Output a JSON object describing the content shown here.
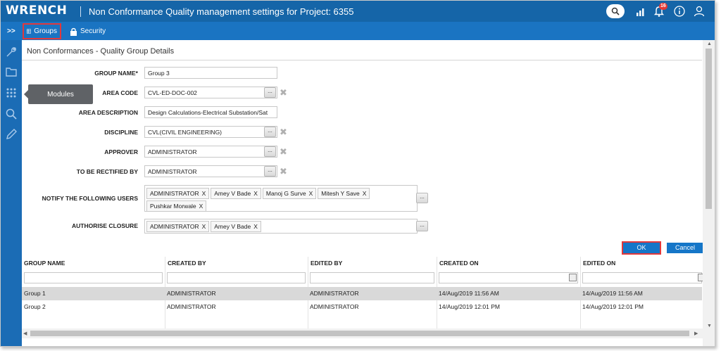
{
  "header": {
    "logo": "WRENCH",
    "title": "Non Conformance Quality management settings for Project: 6355",
    "notification_count": "16",
    "icons": [
      "search-icon",
      "signal-icon",
      "bell-icon",
      "info-icon",
      "user-icon"
    ]
  },
  "tabs": [
    {
      "label": "Groups",
      "icon": "grid-icon"
    },
    {
      "label": "Security",
      "icon": "lock-icon"
    }
  ],
  "sidebar": {
    "expand": ">>",
    "icons": [
      "wrench-icon",
      "folder-icon",
      "modules-icon",
      "search-icon",
      "pencil-icon"
    ],
    "tooltip": "Modules"
  },
  "section_title": "Non Conformances - Quality Group Details",
  "form": {
    "group_name": {
      "label": "GROUP NAME*",
      "value": "Group 3"
    },
    "area_code": {
      "label": "AREA CODE",
      "value": "CVL-ED-DOC-002"
    },
    "area_description": {
      "label": "AREA DESCRIPTION",
      "value": "Design Calculations-Electrical Substation/Sat"
    },
    "discipline": {
      "label": "DISCIPLINE",
      "value": "CVL(CIVIL ENGINEERING)"
    },
    "approver": {
      "label": "APPROVER",
      "value": "ADMINISTRATOR"
    },
    "to_be_rectified_by": {
      "label": "TO BE RECTIFIED BY",
      "value": "ADMINISTRATOR"
    },
    "notify_users": {
      "label": "NOTIFY THE FOLLOWING USERS",
      "tags": [
        "ADMINISTRATOR",
        "Amey V Bade",
        "Manoj G Surve",
        "Mitesh Y Save",
        "Pushkar Morwale"
      ]
    },
    "authorise_closure": {
      "label": "AUTHORISE CLOSURE",
      "tags": [
        "ADMINISTRATOR",
        "Amey V Bade"
      ]
    },
    "dots_label": "...",
    "clear_label": "✖",
    "tag_remove": "X"
  },
  "buttons": {
    "ok": "OK",
    "cancel": "Cancel"
  },
  "grid": {
    "columns": [
      "GROUP NAME",
      "CREATED BY",
      "EDITED BY",
      "CREATED ON",
      "EDITED ON"
    ],
    "rows": [
      [
        "Group 1",
        "ADMINISTRATOR",
        "ADMINISTRATOR",
        "14/Aug/2019 11:56 AM",
        "14/Aug/2019 11:56 AM"
      ],
      [
        "Group 2",
        "ADMINISTRATOR",
        "ADMINISTRATOR",
        "14/Aug/2019 12:01 PM",
        "14/Aug/2019 12:01 PM"
      ]
    ]
  },
  "colors": {
    "header": "#1565a8",
    "subbar": "#1a74c2",
    "accent": "#1576c8",
    "highlight": "#e2383b"
  }
}
